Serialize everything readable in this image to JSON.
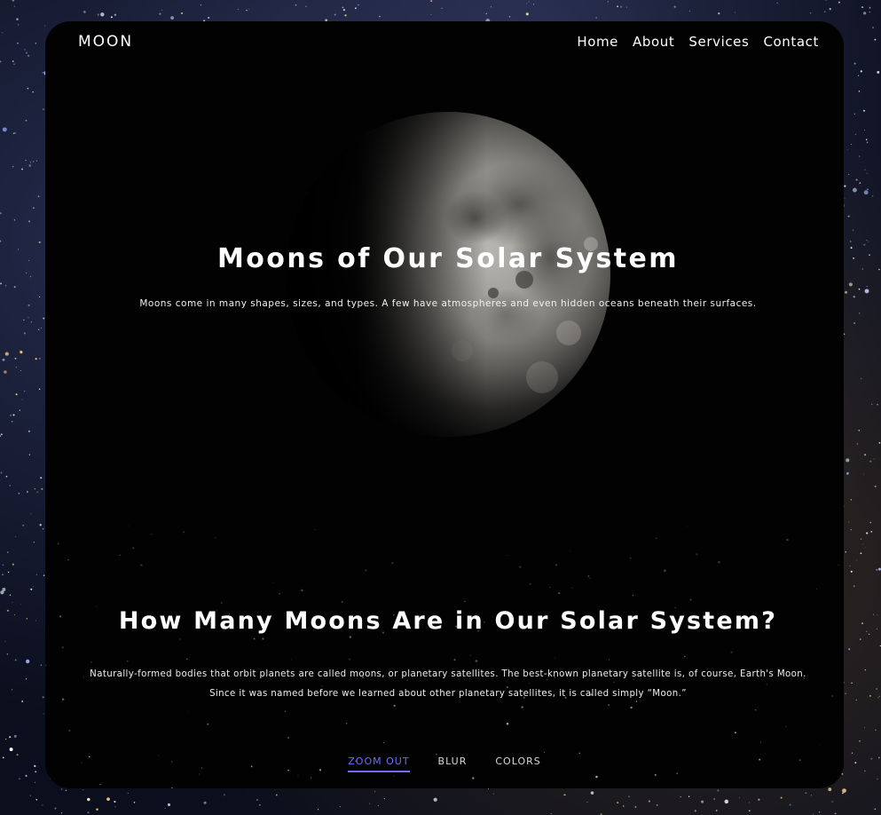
{
  "nav": {
    "logo": "MOON",
    "links": [
      "Home",
      "About",
      "Services",
      "Contact"
    ]
  },
  "hero": {
    "title": "Moons of Our Solar System",
    "subtitle": "Moons come in many shapes, sizes, and types. A few have atmospheres and even hidden oceans beneath their surfaces."
  },
  "section": {
    "title": "How Many Moons Are in Our Solar System?",
    "line1": "Naturally-formed bodies that orbit planets are called moons, or planetary satellites. The best-known planetary satellite is, of course, Earth's Moon.",
    "line2": "Since it was named before we learned about other planetary satellites, it is called simply “Moon.”"
  },
  "tabs": [
    {
      "label": "ZOOM OUT",
      "active": true
    },
    {
      "label": "BLUR",
      "active": false
    },
    {
      "label": "COLORS",
      "active": false
    }
  ],
  "colors": {
    "accent": "#6d6dff",
    "card": "#020202",
    "text": "#ffffff"
  }
}
